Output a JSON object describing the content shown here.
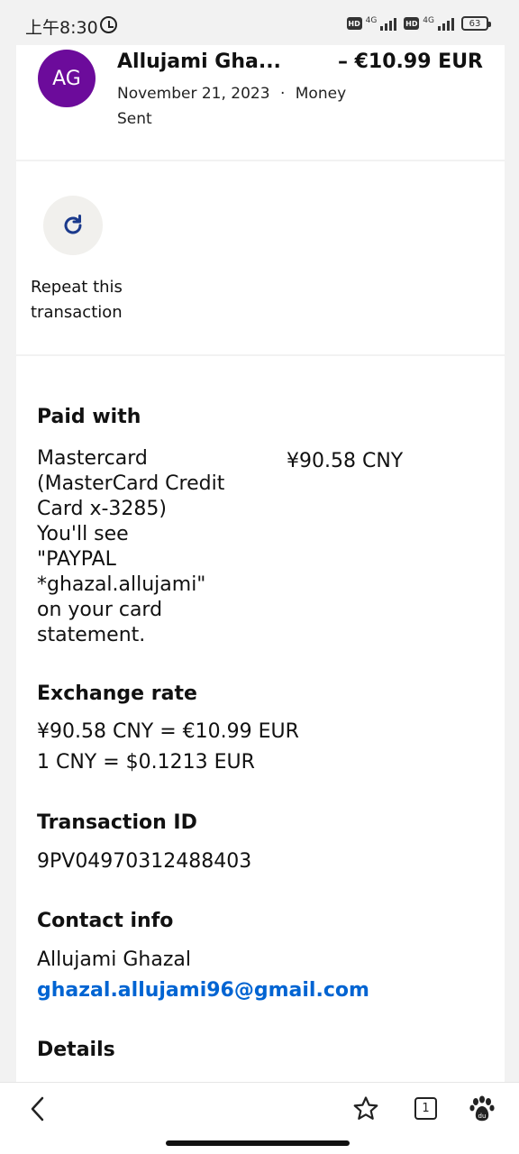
{
  "status_bar": {
    "time": "上午8:30",
    "hd1": "HD",
    "net1": "4G",
    "hd2": "HD",
    "net2": "4G",
    "battery": "63"
  },
  "header": {
    "avatar_initials": "AG",
    "payee_name": "Allujami Gha...",
    "amount": "– €10.99 EUR",
    "date": "November 21, 2023",
    "separator": "·",
    "type": "Money Sent"
  },
  "repeat": {
    "icon": "refresh-icon",
    "label_line1": "Repeat this",
    "label_line2": "transaction"
  },
  "paid_with": {
    "title": "Paid with",
    "lines": [
      "Mastercard",
      "(MasterCard Credit",
      "Card x-3285)",
      "You'll see",
      "\"PAYPAL",
      "*ghazal.allujami\"",
      "on your card",
      "statement."
    ],
    "amount": "¥90.58 CNY"
  },
  "exchange_rate": {
    "title": "Exchange rate",
    "line1": "¥90.58 CNY = €10.99 EUR",
    "line2": "1 CNY = $0.1213 EUR"
  },
  "transaction": {
    "title": "Transaction ID",
    "id": "9PV04970312488403"
  },
  "contact": {
    "title": "Contact info",
    "name": "Allujami Ghazal",
    "email": "ghazal.allujami96@gmail.com"
  },
  "details": {
    "title": "Details"
  },
  "bottom_bar": {
    "tab_count": "1",
    "icons": [
      "back-icon",
      "star-icon",
      "tabs-icon",
      "baidu-paw-icon"
    ]
  },
  "colors": {
    "avatar": "#6c0b9b",
    "link": "#0064d2",
    "repeat_icon": "#1b3a8c"
  }
}
